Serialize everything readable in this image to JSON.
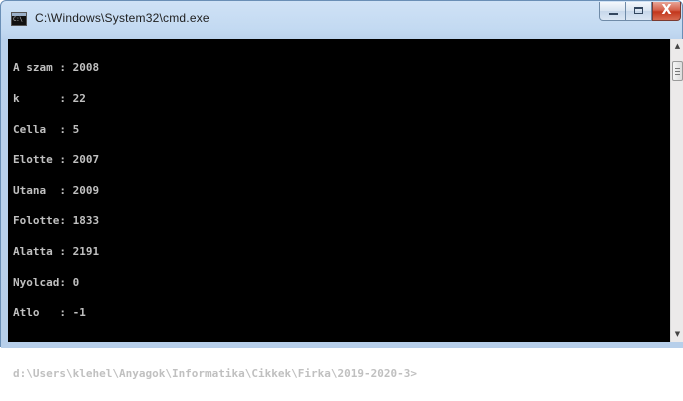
{
  "window": {
    "title": "C:\\Windows\\System32\\cmd.exe",
    "icon": "cmd-icon",
    "icon_text": "C:\\",
    "controls": {
      "minimize": "minimize-icon",
      "maximize": "maximize-icon",
      "close": "close-icon",
      "close_glyph": "X"
    }
  },
  "console": {
    "lines": [
      "A szam : 2008",
      "k      : 22",
      "Cella  : 5",
      "Elotte : 2007",
      "Utana  : 2009",
      "Folotte: 1833",
      "Alatta : 2191",
      "Nyolcad: 0",
      "Atlo   : -1",
      "",
      "d:\\Users\\klehel\\Anyagok\\Informatika\\Cikkek\\Firka\\2019-2020-3>"
    ],
    "background": "#000000",
    "foreground": "#c0c0c0"
  },
  "scrollbar": {
    "up_glyph": "▲",
    "down_glyph": "▼"
  }
}
